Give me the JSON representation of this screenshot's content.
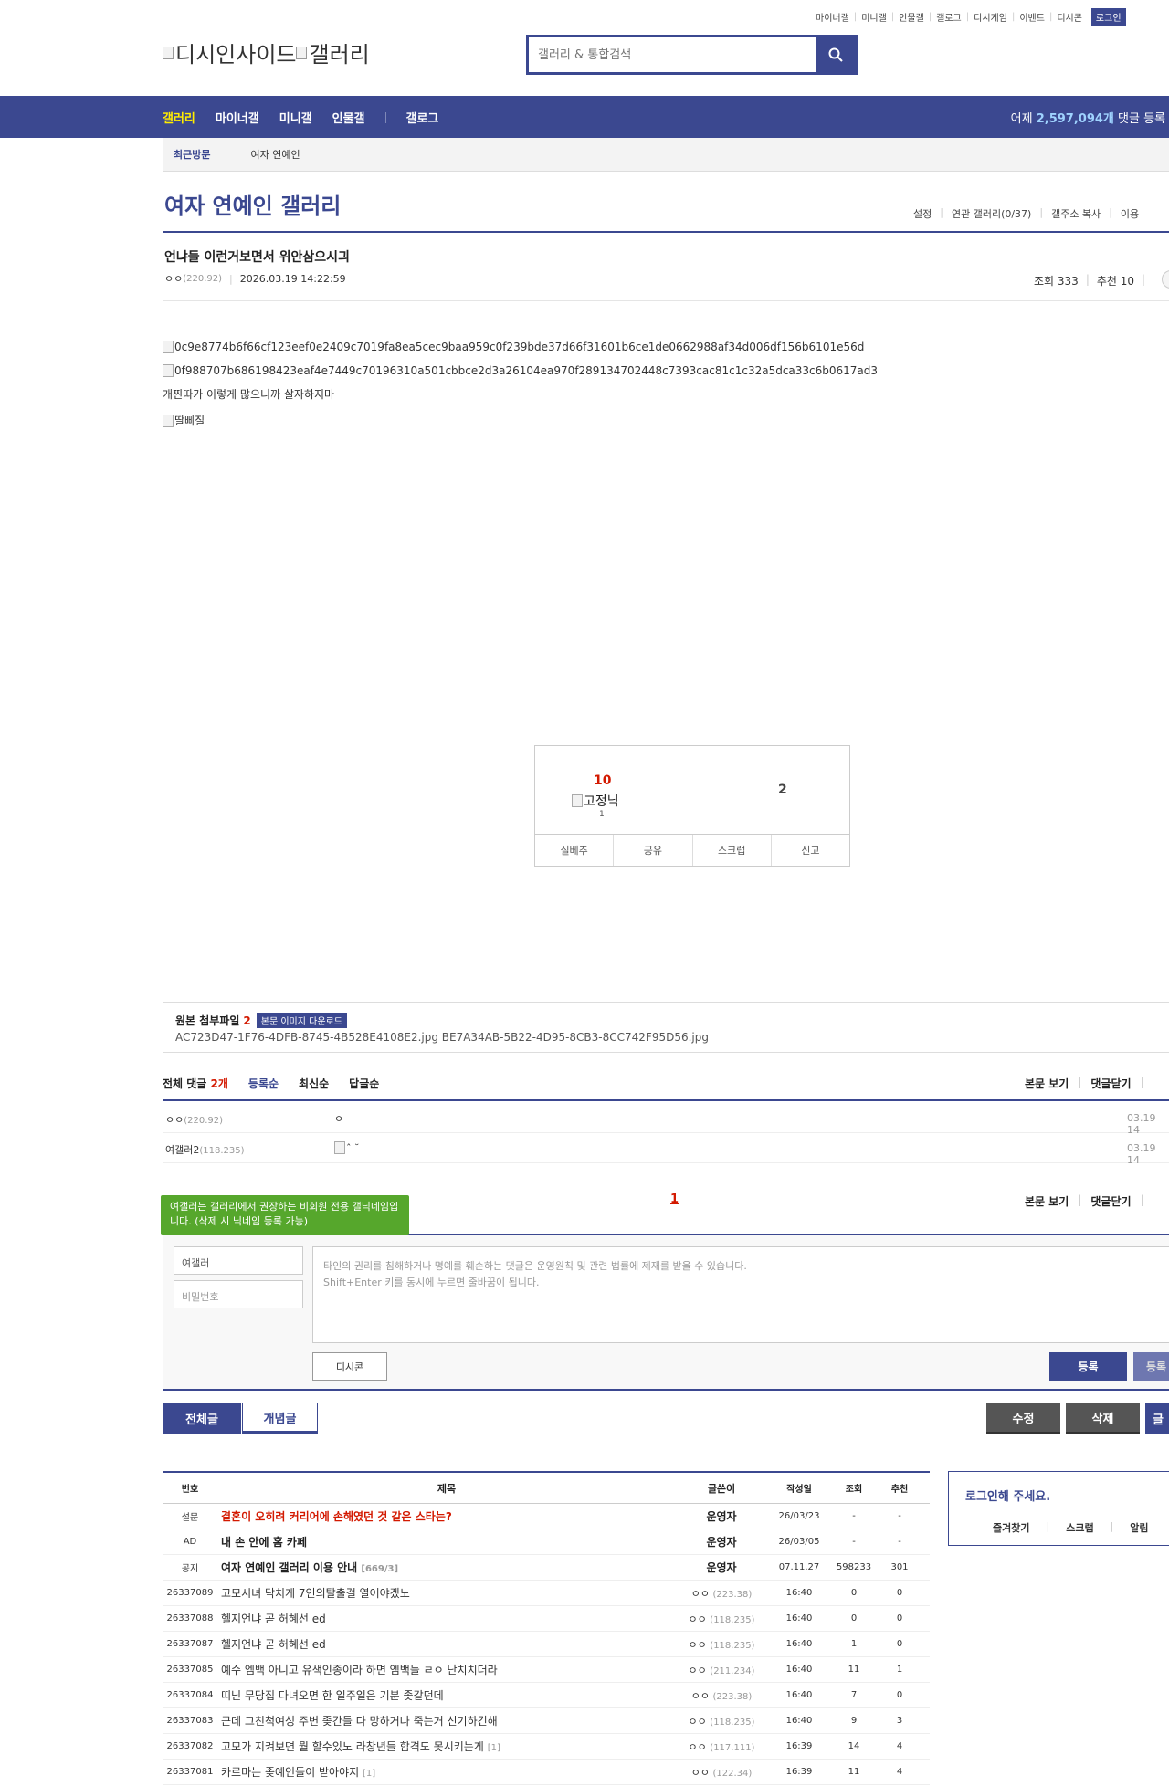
{
  "top_links": [
    "마이너갤",
    "미니갤",
    "인물갤",
    "갤로그",
    "디시게임",
    "이벤트",
    "디시콘"
  ],
  "login_label": "로그인",
  "logo_alt": [
    "디시인사이드",
    "갤러리"
  ],
  "search_placeholder": "갤러리 & 통합검색",
  "gnb": {
    "items": [
      "갤러리",
      "마이너갤",
      "미니갤",
      "인물갤",
      "갤로그"
    ],
    "yesterday_prefix": "어제",
    "yesterday_count": "2,597,094개",
    "yesterday_suffix": "댓글 등록"
  },
  "visit": {
    "label": "최근방문",
    "item": "여자 연예인"
  },
  "gallery_title": "여자 연예인 갤러리",
  "gallery_options": [
    "설정",
    "연관 갤러리(0/37)",
    "갤주소 복사",
    "이용"
  ],
  "post": {
    "title": "언냐들 이런거보면서 위안삼으시긔",
    "nick": "ㅇㅇ",
    "ip": "(220.92)",
    "datetime": "2026.03.19 14:22:59",
    "views_label": "조회 333",
    "rec_label": "추천 10",
    "img1_alt": "0c9e8774b6f66cf123eef0e2409c7019fa8ea5cec9baa959c0f239bde37d66f31601b6ce1de0662988af34d006df156b6101e56d",
    "img2_alt": "0f988707b686198423eaf4e7449c70196310a501cbbce2d3a26104ea970f289134702448c7393cac81c1c32a5dca33c6b0617ad3",
    "text_line": "개찐따가 이렇게 많으니까 살자하지마",
    "img3_alt": "딸삐질"
  },
  "recommend": {
    "up": "10",
    "fix_alt": "고정닉",
    "fix_count": "1",
    "down": "2",
    "buttons": [
      "실베추",
      "공유",
      "스크랩",
      "신고"
    ]
  },
  "attachments": {
    "label": "원본 첨부파일",
    "count": "2",
    "download": "본문 이미지 다운로드",
    "files": "AC723D47-1F76-4DFB-8745-4B528E4108E2.jpg   BE7A34AB-5B22-4D95-8CB3-8CC742F95D56.jpg"
  },
  "comments": {
    "total_prefix": "전체 댓글",
    "total_count": "2개",
    "sorts": [
      "등록순",
      "최신순",
      "답글순"
    ],
    "view_body": "본문 보기",
    "close": "댓글닫기",
    "rows": [
      {
        "nick": "ㅇㅇ",
        "ip": "(220.92)",
        "text": "ㅇ",
        "date": "03.19 14"
      },
      {
        "nick": "여갤러2",
        "ip": "(118.235)",
        "text": "ˆ ˘",
        "date": "03.19 14"
      }
    ],
    "page": "1"
  },
  "tooltip": "여갤러는 갤러리에서 권장하는 비회원 전용 갤닉네임입니다. (삭제 시 닉네임 등록 가능)",
  "write": {
    "nick_value": "여갤러",
    "pw_placeholder": "비밀번호",
    "memo_line1": "타인의 권리를 침해하거나 명예를 훼손하는 댓글은 운영원칙 및 관련 법률에 제재를 받을 수 있습니다.",
    "memo_line2": "Shift+Enter 키를 동시에 누르면 줄바꿈이 됩니다.",
    "dccon": "디시콘",
    "submit": "등록",
    "submit2": "등록"
  },
  "buttons": {
    "all": "전체글",
    "concept": "개념글",
    "edit": "수정",
    "delete": "삭제",
    "write": "글"
  },
  "list": {
    "headers": [
      "번호",
      "제목",
      "글쓴이",
      "작성일",
      "조회",
      "추천"
    ],
    "rows": [
      {
        "num": "설문",
        "title": "결혼이 오히려 커리어에 손해였던 것 같은 스타는?",
        "writer": "운영자",
        "date": "26/03/23",
        "views": "-",
        "rec": "-",
        "type": "survey"
      },
      {
        "num": "AD",
        "title": "내 손 안에 홈 카페",
        "writer": "운영자",
        "date": "26/03/05",
        "views": "-",
        "rec": "-",
        "type": "notice"
      },
      {
        "num": "공지",
        "title": "여자 연예인 갤러리 이용 안내",
        "reply": "[669/3]",
        "writer": "운영자",
        "date": "07.11.27",
        "views": "598233",
        "rec": "301",
        "type": "notice"
      },
      {
        "num": "26337089",
        "title": "고모시녀 닥치게 7인의탈출걸 열어야겠노",
        "writer": "ㅇㅇ",
        "ip": "(223.38)",
        "date": "16:40",
        "views": "0",
        "rec": "0"
      },
      {
        "num": "26337088",
        "title": "헬지언냐 곧 허혜선 ed",
        "writer": "ㅇㅇ",
        "ip": "(118.235)",
        "date": "16:40",
        "views": "0",
        "rec": "0"
      },
      {
        "num": "26337087",
        "title": "헬지언냐 곧 허혜선 ed",
        "writer": "ㅇㅇ",
        "ip": "(118.235)",
        "date": "16:40",
        "views": "1",
        "rec": "0"
      },
      {
        "num": "26337085",
        "title": "예수 엠백 아니고 유색인종이라 하면 엠백들 ㄹㅇ 난치치더라",
        "writer": "ㅇㅇ",
        "ip": "(211.234)",
        "date": "16:40",
        "views": "11",
        "rec": "1"
      },
      {
        "num": "26337084",
        "title": "띠닌 무당집 다녀오면 한 일주일은 기분 좆같던데",
        "writer": "ㅇㅇ",
        "ip": "(223.38)",
        "date": "16:40",
        "views": "7",
        "rec": "0"
      },
      {
        "num": "26337083",
        "title": "근데 그친척여성 주변 좆간들 다 망하거나 죽는거 신기하긴해",
        "writer": "ㅇㅇ",
        "ip": "(118.235)",
        "date": "16:40",
        "views": "9",
        "rec": "3"
      },
      {
        "num": "26337082",
        "title": "고모가 지켜보면 뭘 할수있노 라창년들 합격도 못시키는게",
        "reply": "[1]",
        "writer": "ㅇㅇ",
        "ip": "(117.111)",
        "date": "16:39",
        "views": "14",
        "rec": "4"
      },
      {
        "num": "26337081",
        "title": "카르마는 좆예인들이 받아야지",
        "reply": "[1]",
        "writer": "ㅇㅇ",
        "ip": "(122.34)",
        "date": "16:39",
        "views": "11",
        "rec": "4"
      }
    ]
  },
  "login_box": {
    "title": "로그인해 주세요.",
    "links": [
      "즐겨찾기",
      "스크랩",
      "알림"
    ]
  }
}
